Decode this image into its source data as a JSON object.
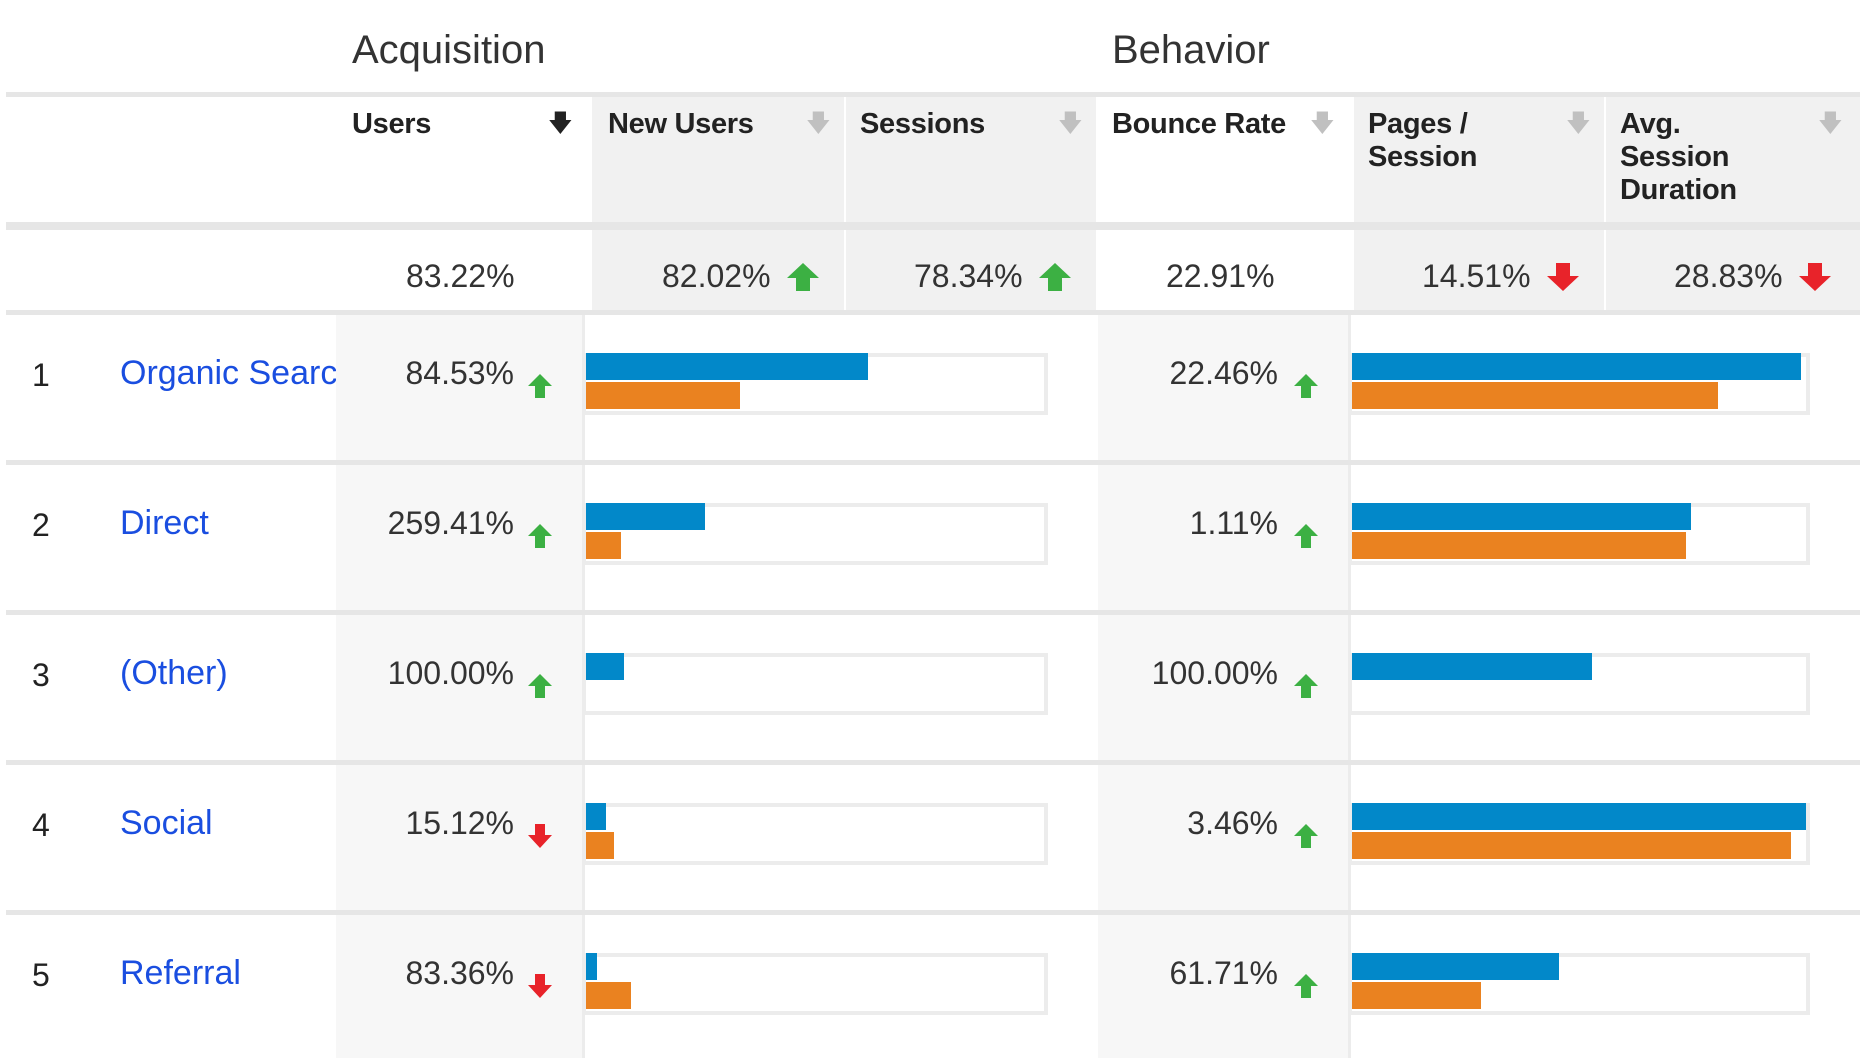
{
  "groups": {
    "acquisition": "Acquisition",
    "behavior": "Behavior"
  },
  "columns": {
    "users": "Users",
    "new_users": "New Users",
    "sessions": "Sessions",
    "bounce_rate": "Bounce Rate",
    "pages_session_line1": "Pages /",
    "pages_session_line2": "Session",
    "avg_session_line1": "Avg.",
    "avg_session_line2": "Session",
    "avg_session_line3": "Duration",
    "sort_icon": "down-arrow-icon"
  },
  "summary": {
    "users": "83.22%",
    "new_users": "82.02%",
    "new_users_trend": "up",
    "sessions": "78.34%",
    "sessions_trend": "up",
    "bounce_rate": "22.91%",
    "pages_session": "14.51%",
    "pages_session_trend": "down",
    "avg_session_duration": "28.83%",
    "avg_session_duration_trend": "down"
  },
  "rows": [
    {
      "rank": "1",
      "channel": "Organic Search",
      "users": "84.53%",
      "users_trend": "up",
      "bounce_rate": "22.46%",
      "bounce_trend": "up",
      "acq_bars": {
        "current": 0.616,
        "previous": 0.336
      },
      "beh_bars": {
        "current": 0.99,
        "previous": 0.806
      }
    },
    {
      "rank": "2",
      "channel": "Direct",
      "users": "259.41%",
      "users_trend": "up",
      "bounce_rate": "1.11%",
      "bounce_trend": "up",
      "acq_bars": {
        "current": 0.259,
        "previous": 0.077
      },
      "beh_bars": {
        "current": 0.746,
        "previous": 0.736
      }
    },
    {
      "rank": "3",
      "channel": "(Other)",
      "users": "100.00%",
      "users_trend": "up",
      "bounce_rate": "100.00%",
      "bounce_trend": "up",
      "acq_bars": {
        "current": 0.082,
        "previous": 0
      },
      "beh_bars": {
        "current": 0.528,
        "previous": 0
      }
    },
    {
      "rank": "4",
      "channel": "Social",
      "users": "15.12%",
      "users_trend": "down",
      "bounce_rate": "3.46%",
      "bounce_trend": "up",
      "acq_bars": {
        "current": 0.044,
        "previous": 0.062
      },
      "beh_bars": {
        "current": 1.0,
        "previous": 0.966
      }
    },
    {
      "rank": "5",
      "channel": "Referral",
      "users": "83.36%",
      "users_trend": "down",
      "bounce_rate": "61.71%",
      "bounce_trend": "up",
      "acq_bars": {
        "current": 0.023,
        "previous": 0.098
      },
      "beh_bars": {
        "current": 0.456,
        "previous": 0.285
      }
    }
  ],
  "colors": {
    "current_bar": "#0288c9",
    "previous_bar": "#ea8220",
    "up_arrow": "#3cb043",
    "down_arrow": "#e8232a",
    "link": "#1a4ee0"
  }
}
